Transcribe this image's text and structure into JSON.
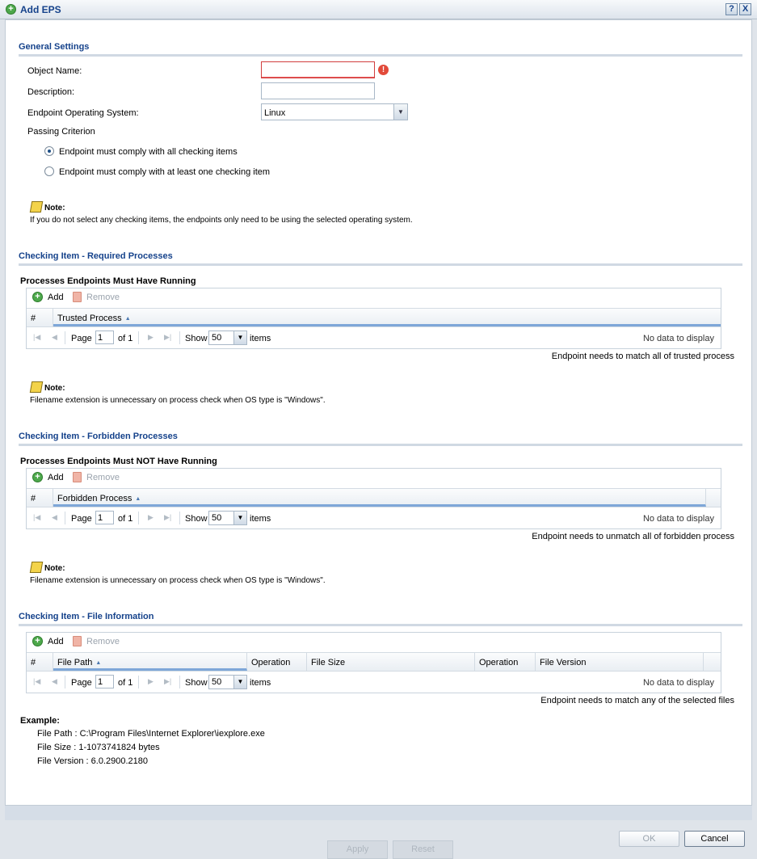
{
  "window": {
    "title": "Add EPS",
    "help_label": "?",
    "close_label": "X"
  },
  "general": {
    "section_title": "General Settings",
    "object_name_label": "Object Name:",
    "object_name_value": "",
    "description_label": "Description:",
    "description_value": "",
    "os_label": "Endpoint Operating System:",
    "os_value": "Linux",
    "passing_label": "Passing Criterion",
    "radio_all": "Endpoint must comply with all checking items",
    "radio_one": "Endpoint must comply with at least one checking item",
    "note_title": "Note:",
    "note_text": "If you do not select any checking items, the endpoints only need to be using the selected operating system."
  },
  "required": {
    "section_title": "Checking Item - Required Processes",
    "sub_title": "Processes Endpoints Must Have Running",
    "add_label": "Add",
    "remove_label": "Remove",
    "col_num": "#",
    "col_name": "Trusted Process",
    "match_text": "Endpoint needs to match all of trusted process",
    "note_title": "Note:",
    "note_text": "Filename extension is unnecessary on process check when OS type is \"Windows\"."
  },
  "forbidden": {
    "section_title": "Checking Item - Forbidden Processes",
    "sub_title": "Processes Endpoints Must NOT Have Running",
    "add_label": "Add",
    "remove_label": "Remove",
    "col_num": "#",
    "col_name": "Forbidden Process",
    "match_text": "Endpoint needs to unmatch all of forbidden process",
    "note_title": "Note:",
    "note_text": "Filename extension is unnecessary on process check when OS type is \"Windows\"."
  },
  "file_info": {
    "section_title": "Checking Item - File Information",
    "add_label": "Add",
    "remove_label": "Remove",
    "col_num": "#",
    "col_path": "File Path",
    "col_op1": "Operation",
    "col_size": "File Size",
    "col_op2": "Operation",
    "col_version": "File Version",
    "match_text": "Endpoint needs to match any of the selected files"
  },
  "pager": {
    "page_label": "Page",
    "page_value": "1",
    "of_label": "of 1",
    "show_label": "Show",
    "show_value": "50",
    "items_label": "items",
    "no_data": "No data to display"
  },
  "example": {
    "title": "Example:",
    "path": "File Path : C:\\Program Files\\Internet Explorer\\iexplore.exe",
    "size": "File Size : 1-1073741824 bytes",
    "version": "File Version : 6.0.2900.2180"
  },
  "footer": {
    "ok_label": "OK",
    "cancel_label": "Cancel",
    "apply_label": "Apply",
    "reset_label": "Reset"
  }
}
